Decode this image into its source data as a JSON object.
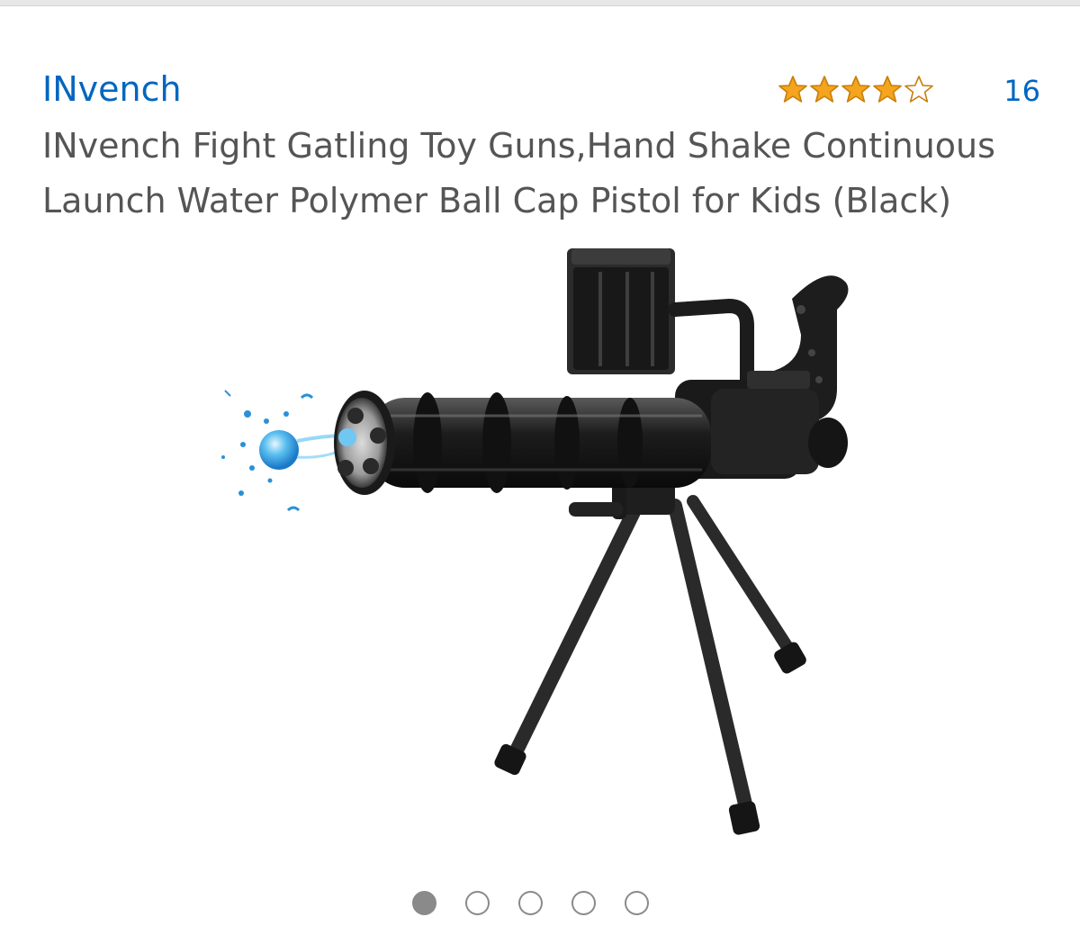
{
  "product": {
    "brand": "INvench",
    "title": "INvench Fight Gatling Toy Guns,Hand Shake Continuous Launch Water Polymer Ball Cap Pistol for Kids (Black)",
    "rating": 4,
    "max_rating": 5,
    "review_count": "16",
    "image_icon": "gatling-toy-gun-image"
  },
  "carousel": {
    "total": 5,
    "active_index": 0
  },
  "colors": {
    "link": "#0066c0",
    "title": "#555555",
    "star_fill": "#f4a41d",
    "star_outline": "#c77e0a",
    "dot": "#8a8a8a"
  }
}
